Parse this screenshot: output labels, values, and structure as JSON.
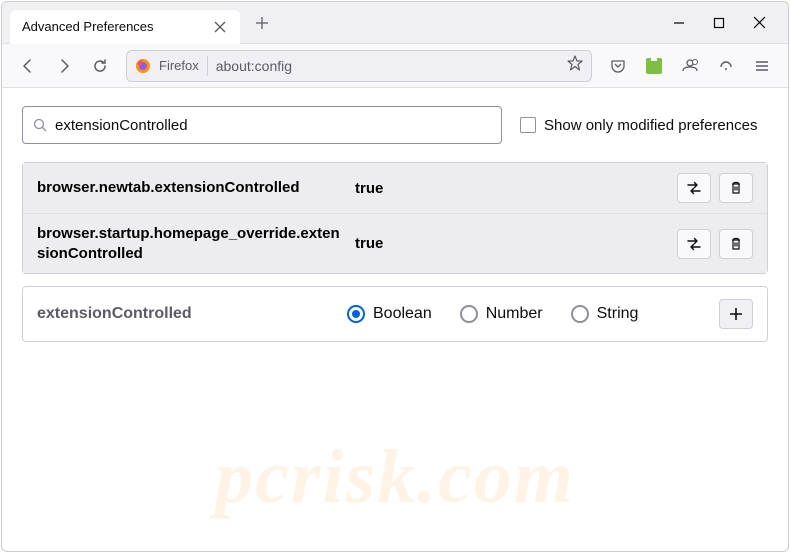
{
  "tab": {
    "title": "Advanced Preferences"
  },
  "addressbar": {
    "identity": "Firefox",
    "url": "about:config"
  },
  "search": {
    "value": "extensionControlled",
    "checkbox_label": "Show only modified preferences"
  },
  "prefs": [
    {
      "name": "browser.newtab.extensionControlled",
      "value": "true"
    },
    {
      "name": "browser.startup.homepage_override.extensionControlled",
      "value": "true"
    }
  ],
  "new_pref": {
    "name": "extensionControlled",
    "types": [
      {
        "label": "Boolean",
        "selected": true
      },
      {
        "label": "Number",
        "selected": false
      },
      {
        "label": "String",
        "selected": false
      }
    ]
  },
  "watermark": "pcrisk.com"
}
